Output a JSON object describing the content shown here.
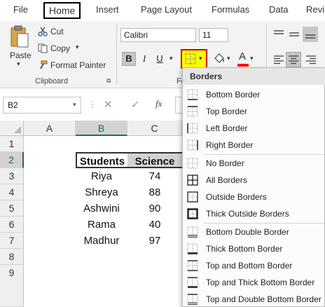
{
  "menu_tabs": [
    "File",
    "Home",
    "Insert",
    "Page Layout",
    "Formulas",
    "Data",
    "Revi"
  ],
  "clipboard": {
    "paste_label": "Paste",
    "cut_label": "Cut",
    "copy_label": "Copy",
    "format_painter_label": "Format Painter",
    "group_label": "Clipboard"
  },
  "font": {
    "name": "Calibri",
    "size": "11",
    "bold_label": "B",
    "italic_label": "I",
    "underline_label": "U",
    "group_label_partial": "Fo"
  },
  "formula_bar": {
    "name_box": "B2",
    "fx_label": "fx"
  },
  "grid": {
    "columns": [
      "A",
      "B",
      "C"
    ],
    "rows": [
      "1",
      "2",
      "3",
      "4",
      "5",
      "6",
      "7",
      "8",
      "9"
    ],
    "header_row": [
      "Students",
      "Science"
    ],
    "data_rows": [
      [
        "Riya",
        "74"
      ],
      [
        "Shreya",
        "88"
      ],
      [
        "Ashwini",
        "90"
      ],
      [
        "Rama",
        "40"
      ],
      [
        "Madhur",
        "97"
      ]
    ]
  },
  "borders_menu": {
    "title": "Borders",
    "items": [
      "Bottom Border",
      "Top Border",
      "Left Border",
      "Right Border",
      "No Border",
      "All Borders",
      "Outside Borders",
      "Thick Outside Borders",
      "Bottom Double Border",
      "Thick Bottom Border",
      "Top and Bottom Border",
      "Top and Thick Bottom Border",
      "Top and Double Bottom Border"
    ]
  },
  "colors": {
    "excel_green": "#217346",
    "highlight_yellow": "#ffff00",
    "selected_border_red": "#e00000",
    "font_color_red": "#ff0000"
  }
}
